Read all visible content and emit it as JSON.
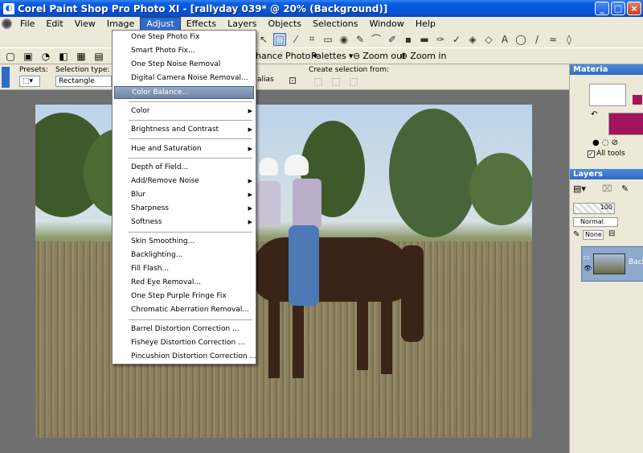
{
  "window": {
    "title": "Corel Paint Shop Pro Photo XI - [rallyday 039* @  20% (Background)]"
  },
  "menubar": [
    "File",
    "Edit",
    "View",
    "Image",
    "Adjust",
    "Effects",
    "Layers",
    "Objects",
    "Selections",
    "Window",
    "Help"
  ],
  "toolbar2": {
    "enhance_photo": "hance Photo",
    "palettes": "Palettes",
    "zoom_out": "Zoom out",
    "zoom_in": "Zoom in"
  },
  "tool_options": {
    "presets_label": "Presets:",
    "selection_type_label": "Selection type:",
    "selection_type_value": "Rectangle",
    "antialias_fragment": "alias",
    "create_selection_label": "Create selection from:"
  },
  "adjust_menu": {
    "items": [
      {
        "label": "One Step Photo Fix",
        "submenu": false
      },
      {
        "label": "Smart Photo Fix...",
        "submenu": false
      },
      {
        "label": "One Step Noise Removal",
        "submenu": false
      },
      {
        "label": "Digital Camera Noise Removal...",
        "submenu": false
      },
      {
        "label": "Color Balance...",
        "submenu": false,
        "highlighted": true
      },
      {
        "label": "Color",
        "submenu": true
      },
      {
        "label": "Brightness and Contrast",
        "submenu": true
      },
      {
        "label": "Hue and Saturation",
        "submenu": true
      },
      {
        "label": "Depth of Field...",
        "submenu": false
      },
      {
        "label": "Add/Remove Noise",
        "submenu": true
      },
      {
        "label": "Blur",
        "submenu": true
      },
      {
        "label": "Sharpness",
        "submenu": true
      },
      {
        "label": "Softness",
        "submenu": true
      },
      {
        "label": "Skin Smoothing...",
        "submenu": false
      },
      {
        "label": "Backlighting...",
        "submenu": false
      },
      {
        "label": "Fill Flash...",
        "submenu": false
      },
      {
        "label": "Red Eye Removal...",
        "submenu": false
      },
      {
        "label": "One Step Purple Fringe Fix",
        "submenu": false
      },
      {
        "label": "Chromatic Aberration Removal...",
        "submenu": false
      },
      {
        "label": "Barrel Distortion Correction ...",
        "submenu": false
      },
      {
        "label": "Fisheye Distortion Correction ...",
        "submenu": false
      },
      {
        "label": "Pincushion Distortion Correction ...",
        "submenu": false
      }
    ]
  },
  "materials": {
    "title": "Materia",
    "all_tools_label": "All tools",
    "foreground_color": "#ffffff",
    "background_color": "#a3145e"
  },
  "layers": {
    "title": "Layers",
    "opacity": "100",
    "blend_mode": "Normal",
    "layer_name": "Backg",
    "mask_value": "None"
  }
}
